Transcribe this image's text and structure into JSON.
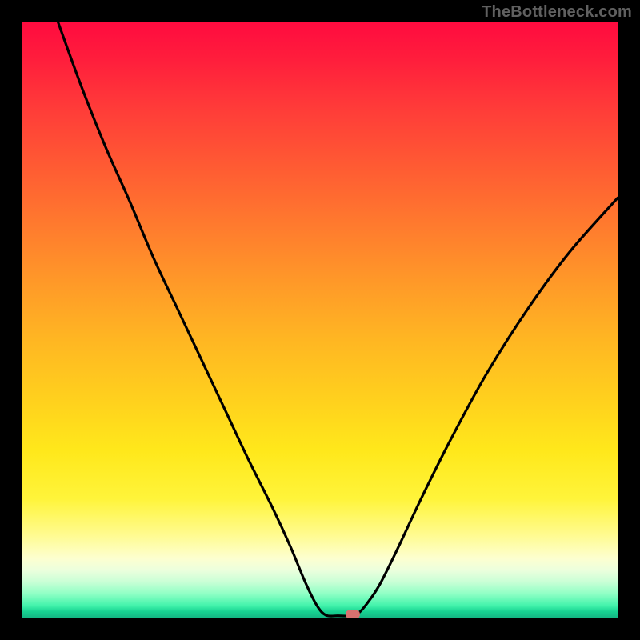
{
  "watermark": "TheBottleneck.com",
  "colors": {
    "page_bg": "#000000",
    "watermark": "#606060",
    "curve_stroke": "#000000",
    "marker_fill": "#d7716f",
    "gradient_stops": [
      "#ff0b3f",
      "#ff1d3c",
      "#ff3a39",
      "#ff5a33",
      "#ff7a2e",
      "#ff9a28",
      "#ffb822",
      "#ffd21d",
      "#ffe81b",
      "#fff43a",
      "#fffb8e",
      "#fdffcf",
      "#ecffdd",
      "#c9ffd6",
      "#8fffc5",
      "#42f3ab",
      "#17d291",
      "#14b783"
    ]
  },
  "chart_data": {
    "type": "line",
    "title": "",
    "xlabel": "",
    "ylabel": "",
    "xlim": [
      0,
      100
    ],
    "ylim": [
      0,
      100
    ],
    "grid": false,
    "legend": false,
    "curve": [
      {
        "x": 6.0,
        "y": 100.0
      },
      {
        "x": 10.0,
        "y": 89.0
      },
      {
        "x": 14.0,
        "y": 79.0
      },
      {
        "x": 18.0,
        "y": 70.0
      },
      {
        "x": 22.0,
        "y": 60.5
      },
      {
        "x": 26.0,
        "y": 52.0
      },
      {
        "x": 30.0,
        "y": 43.5
      },
      {
        "x": 34.0,
        "y": 35.0
      },
      {
        "x": 38.0,
        "y": 26.5
      },
      {
        "x": 42.0,
        "y": 18.5
      },
      {
        "x": 45.0,
        "y": 12.0
      },
      {
        "x": 47.5,
        "y": 6.0
      },
      {
        "x": 49.5,
        "y": 2.0
      },
      {
        "x": 51.0,
        "y": 0.4
      },
      {
        "x": 53.0,
        "y": 0.3
      },
      {
        "x": 55.0,
        "y": 0.3
      },
      {
        "x": 56.5,
        "y": 0.8
      },
      {
        "x": 58.0,
        "y": 2.5
      },
      {
        "x": 60.0,
        "y": 5.5
      },
      {
        "x": 63.0,
        "y": 11.5
      },
      {
        "x": 67.0,
        "y": 20.0
      },
      {
        "x": 72.0,
        "y": 30.0
      },
      {
        "x": 78.0,
        "y": 41.0
      },
      {
        "x": 85.0,
        "y": 52.0
      },
      {
        "x": 92.0,
        "y": 61.5
      },
      {
        "x": 100.0,
        "y": 70.5
      }
    ],
    "marker": {
      "x": 55.5,
      "y": 0.5
    }
  }
}
